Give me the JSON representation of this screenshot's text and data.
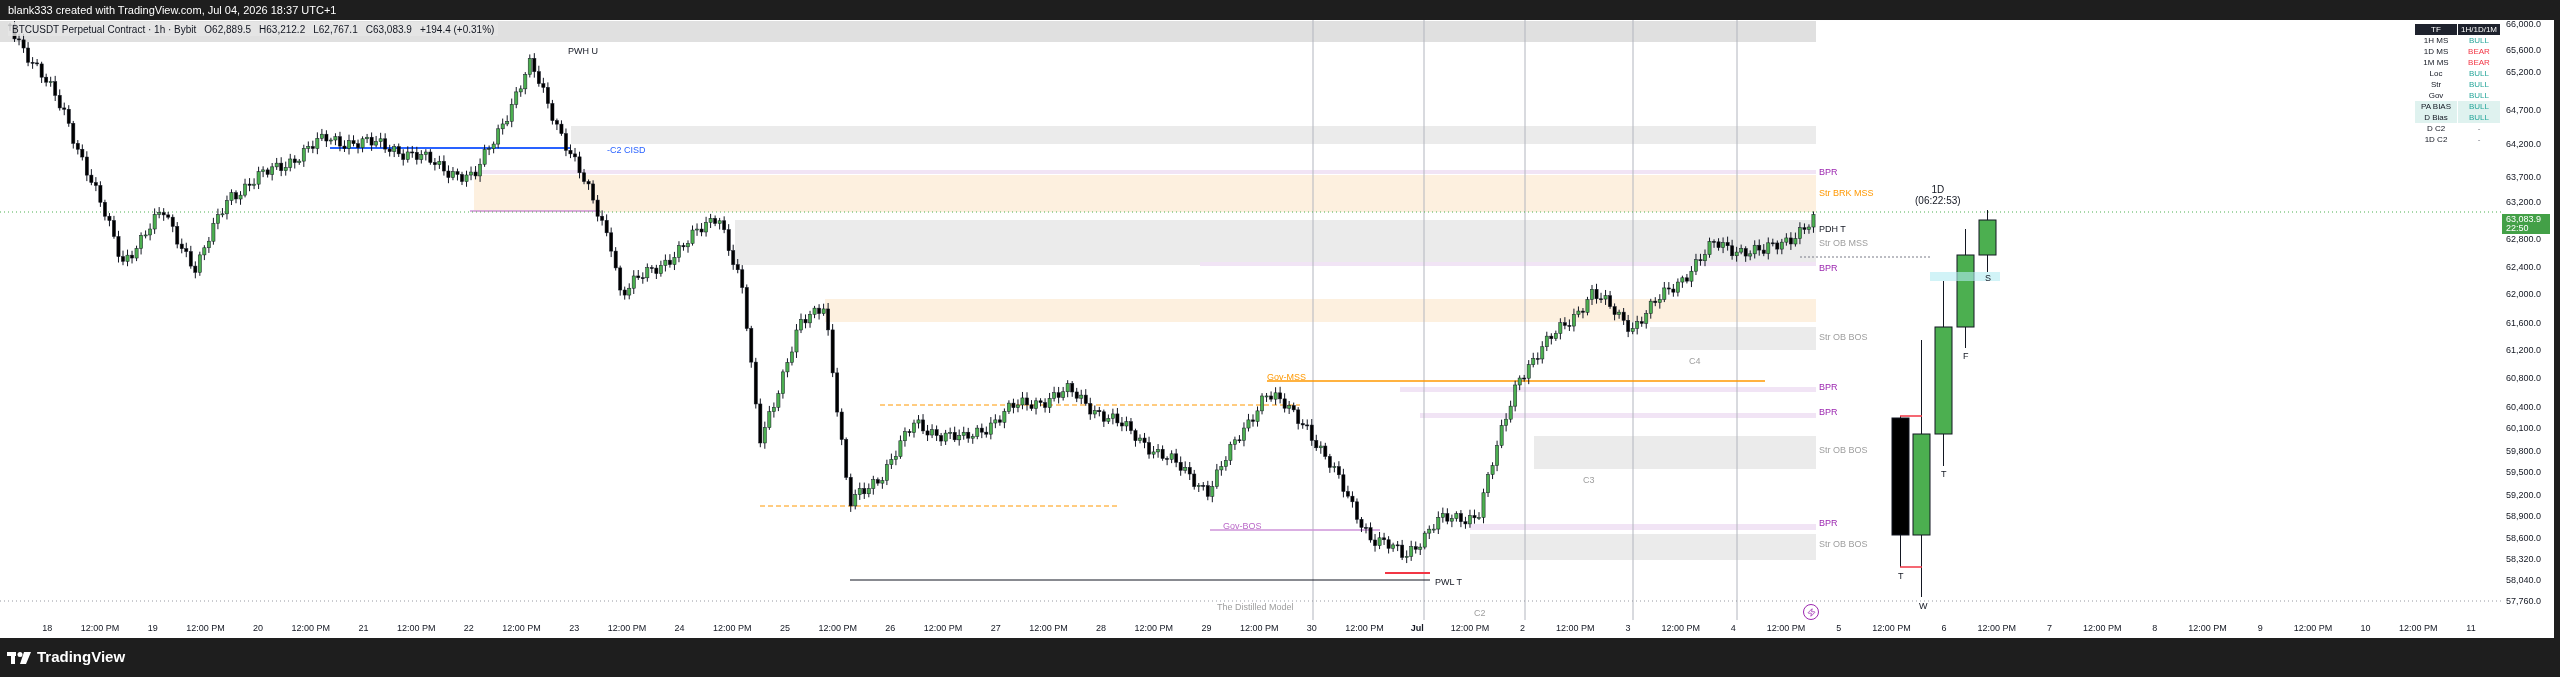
{
  "header": {
    "caption": "blank333 created with TradingView.com, Jul 04, 2026 18:37 UTC+1"
  },
  "legend": {
    "symbol": "BTCUSDT Perpetual Contract · 1h · Bybit",
    "ohlc": [
      {
        "label": "O",
        "value": "62,889.5"
      },
      {
        "label": "H",
        "value": "63,212.2"
      },
      {
        "label": "L",
        "value": "62,767.1"
      },
      {
        "label": "C",
        "value": "63,083.9"
      }
    ],
    "change": "+194.4 (+0.31%)"
  },
  "bias_table": {
    "columns": [
      "TF",
      "1H/1D/1M"
    ],
    "rows": [
      {
        "label": "1H MS",
        "value": "BULL",
        "kind": "bull",
        "highlighted": false
      },
      {
        "label": "1D MS",
        "value": "BEAR",
        "kind": "bear",
        "highlighted": false
      },
      {
        "label": "1M MS",
        "value": "BEAR",
        "kind": "bear",
        "highlighted": false
      },
      {
        "label": "Loc",
        "value": "BULL",
        "kind": "bull",
        "highlighted": false
      },
      {
        "label": "Str",
        "value": "BULL",
        "kind": "bull",
        "highlighted": false
      },
      {
        "label": "Gov",
        "value": "BULL",
        "kind": "bull",
        "highlighted": false
      },
      {
        "label": "PA BIAS",
        "value": "BULL",
        "kind": "bull",
        "highlighted": true
      },
      {
        "label": "D Bias",
        "value": "BULL",
        "kind": "bull",
        "highlighted": true
      },
      {
        "label": "D C2",
        "value": "-",
        "kind": "none",
        "highlighted": false
      },
      {
        "label": "1D C2",
        "value": "-",
        "kind": "none",
        "highlighted": false
      }
    ]
  },
  "annotations": [
    {
      "text": "PWH U",
      "kind": "level"
    },
    {
      "text": "-C2 CISD",
      "kind": "cisd"
    },
    {
      "text": "Gov-MSS",
      "kind": "mss"
    },
    {
      "text": "Gov-BOS",
      "kind": "bos"
    },
    {
      "text": "PWL T",
      "kind": "level"
    },
    {
      "text": "The Distilled Model",
      "kind": "faint"
    },
    {
      "text": "C2",
      "kind": "faint"
    },
    {
      "text": "C3",
      "kind": "faint"
    },
    {
      "text": "C4",
      "kind": "faint"
    },
    {
      "text": "BPR",
      "kind": "bpr"
    },
    {
      "text": "Str BRK MSS",
      "kind": "mss"
    },
    {
      "text": "PDH T",
      "kind": "level"
    },
    {
      "text": "Str OB MSS",
      "kind": "faint"
    },
    {
      "text": "BPR",
      "kind": "bpr"
    },
    {
      "text": "Str OB BOS",
      "kind": "faint"
    },
    {
      "text": "BPR",
      "kind": "bpr"
    },
    {
      "text": "BPR",
      "kind": "bpr"
    },
    {
      "text": "Str OB BOS",
      "kind": "faint"
    },
    {
      "text": "BPR",
      "kind": "bpr"
    },
    {
      "text": "Str OB BOS",
      "kind": "faint"
    },
    {
      "text": "T",
      "kind": "level"
    },
    {
      "text": "W",
      "kind": "level"
    },
    {
      "text": "T",
      "kind": "level"
    },
    {
      "text": "F",
      "kind": "level"
    },
    {
      "text": "S",
      "kind": "level"
    }
  ],
  "daily_label": {
    "timeframe": "1D",
    "countdown": "(06:22:53)"
  },
  "price_axis": {
    "ticks": [
      "66,000.0",
      "65,600.0",
      "65,200.0",
      "64,700.0",
      "64,200.0",
      "63,700.0",
      "63,200.0",
      "62,800.0",
      "62,400.0",
      "62,000.0",
      "61,600.0",
      "61,200.0",
      "60,800.0",
      "60,400.0",
      "60,100.0",
      "59,800.0",
      "59,500.0",
      "59,200.0",
      "58,900.0",
      "58,600.0",
      "58,320.0",
      "58,040.0",
      "57,760.0"
    ],
    "last_price": "63,083.9",
    "countdown": "22:50"
  },
  "time_axis": {
    "ticks": [
      {
        "label": "18",
        "bold": false
      },
      {
        "label": "12:00 PM",
        "bold": false
      },
      {
        "label": "19",
        "bold": false
      },
      {
        "label": "12:00 PM",
        "bold": false
      },
      {
        "label": "20",
        "bold": false
      },
      {
        "label": "12:00 PM",
        "bold": false
      },
      {
        "label": "21",
        "bold": false
      },
      {
        "label": "12:00 PM",
        "bold": false
      },
      {
        "label": "22",
        "bold": false
      },
      {
        "label": "12:00 PM",
        "bold": false
      },
      {
        "label": "23",
        "bold": false
      },
      {
        "label": "12:00 PM",
        "bold": false
      },
      {
        "label": "24",
        "bold": false
      },
      {
        "label": "12:00 PM",
        "bold": false
      },
      {
        "label": "25",
        "bold": false
      },
      {
        "label": "12:00 PM",
        "bold": false
      },
      {
        "label": "26",
        "bold": false
      },
      {
        "label": "12:00 PM",
        "bold": false
      },
      {
        "label": "27",
        "bold": false
      },
      {
        "label": "12:00 PM",
        "bold": false
      },
      {
        "label": "28",
        "bold": false
      },
      {
        "label": "12:00 PM",
        "bold": false
      },
      {
        "label": "29",
        "bold": false
      },
      {
        "label": "12:00 PM",
        "bold": false
      },
      {
        "label": "30",
        "bold": false
      },
      {
        "label": "12:00 PM",
        "bold": false
      },
      {
        "label": "Jul",
        "bold": true
      },
      {
        "label": "12:00 PM",
        "bold": false
      },
      {
        "label": "2",
        "bold": false
      },
      {
        "label": "12:00 PM",
        "bold": false
      },
      {
        "label": "3",
        "bold": false
      },
      {
        "label": "12:00 PM",
        "bold": false
      },
      {
        "label": "4",
        "bold": false
      },
      {
        "label": "12:00 PM",
        "bold": false
      },
      {
        "label": "5",
        "bold": false
      },
      {
        "label": "12:00 PM",
        "bold": false
      },
      {
        "label": "6",
        "bold": false
      },
      {
        "label": "12:00 PM",
        "bold": false
      },
      {
        "label": "7",
        "bold": false
      },
      {
        "label": "12:00 PM",
        "bold": false
      },
      {
        "label": "8",
        "bold": false
      },
      {
        "label": "12:00 PM",
        "bold": false
      },
      {
        "label": "9",
        "bold": false
      },
      {
        "label": "12:00 PM",
        "bold": false
      },
      {
        "label": "10",
        "bold": false
      },
      {
        "label": "12:00 PM",
        "bold": false
      },
      {
        "label": "11",
        "bold": false
      }
    ]
  },
  "footer": {
    "brand": "TradingView"
  }
}
